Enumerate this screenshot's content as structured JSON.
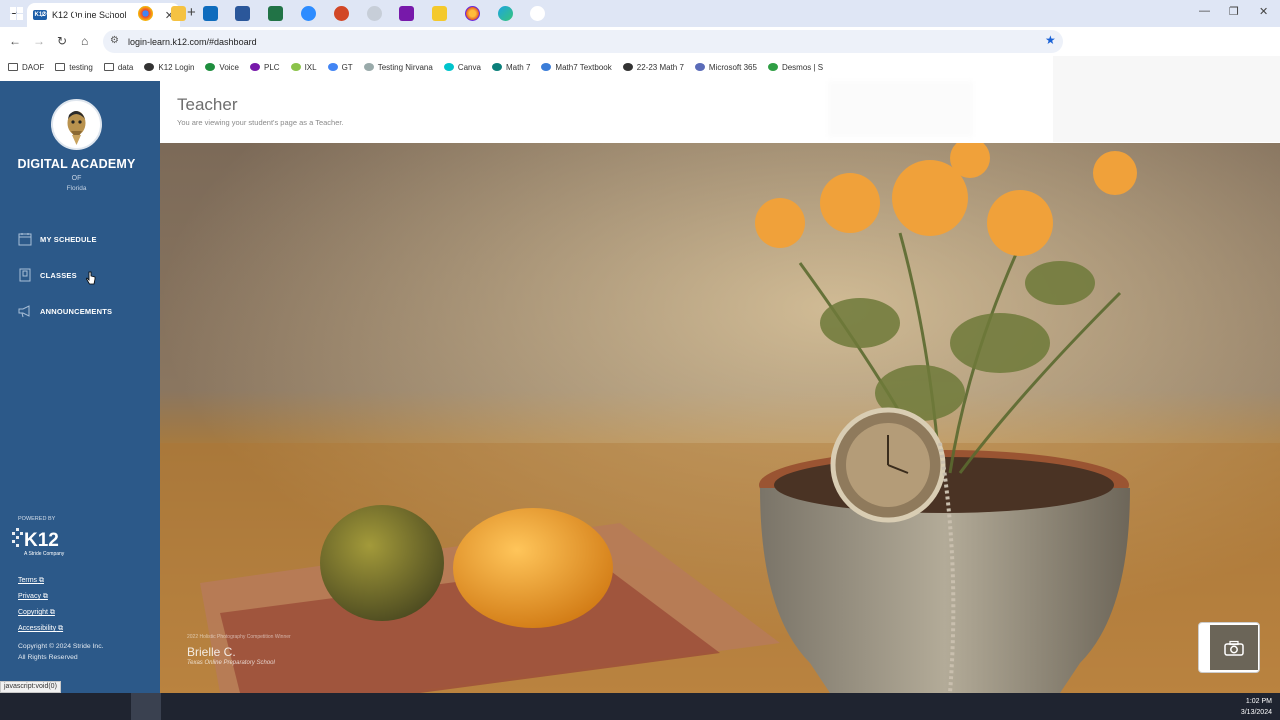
{
  "browser": {
    "tab_title": "K12 Online School",
    "tab_favicon_text": "K12",
    "url": "login-learn.k12.com/#dashboard",
    "bookmarks": [
      {
        "label": "DAOF",
        "icon": "folder-icon"
      },
      {
        "label": "testing",
        "icon": "folder-icon"
      },
      {
        "label": "data",
        "icon": "folder-icon"
      },
      {
        "label": "K12 Login",
        "icon": "k12-icon"
      },
      {
        "label": "Voice",
        "icon": "phone-icon"
      },
      {
        "label": "PLC",
        "icon": "onenote-icon"
      },
      {
        "label": "IXL",
        "icon": "ixl-icon"
      },
      {
        "label": "GT",
        "icon": "translate-icon"
      },
      {
        "label": "Testing Nirvana",
        "icon": "nirvana-icon"
      },
      {
        "label": "Canva",
        "icon": "canva-icon"
      },
      {
        "label": "Math 7",
        "icon": "book-icon"
      },
      {
        "label": "Math7 Textbook",
        "icon": "textbook-icon"
      },
      {
        "label": "22-23 Math 7",
        "icon": "divide-icon"
      },
      {
        "label": "Microsoft 365",
        "icon": "gear-icon"
      },
      {
        "label": "Desmos | S",
        "icon": "desmos-icon"
      }
    ]
  },
  "sidebar": {
    "school_name": "DIGITAL ACADEMY",
    "school_of": "OF",
    "school_state": "Florida",
    "nav": [
      {
        "label": "MY SCHEDULE",
        "icon": "calendar-icon"
      },
      {
        "label": "CLASSES",
        "icon": "book-icon"
      },
      {
        "label": "ANNOUNCEMENTS",
        "icon": "megaphone-icon"
      }
    ],
    "powered_by": "POWERED BY",
    "brand": "K12",
    "brand_sub": "A Stride Company",
    "footer_links": [
      "Terms",
      "Privacy",
      "Copyright",
      "Accessibility"
    ],
    "copyright_line1": "Copyright © 2024 Stride Inc.",
    "copyright_line2": "All Rights Reserved"
  },
  "main": {
    "title": "Teacher",
    "subtitle": "You are viewing your student's page as a Teacher.",
    "photo_credit_small": "2022 Holistic Photography Competition Winner",
    "photo_credit_name": "Brielle C.",
    "photo_credit_school": "Texas Online Preparatory School"
  },
  "status_tooltip": "javascript:void(0)",
  "taskbar": {
    "time": "1:02 PM",
    "date": "3/13/2024"
  },
  "colors": {
    "sidebar": "#2c5989",
    "tabstrip": "#dfe6f5",
    "taskbar": "#1f2430"
  }
}
